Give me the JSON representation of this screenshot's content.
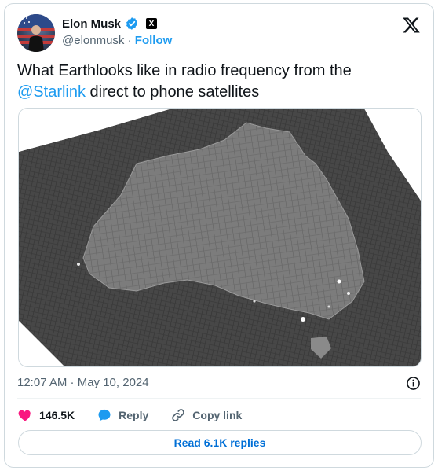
{
  "author": {
    "name": "Elon Musk",
    "handle": "@elonmusk",
    "separator": "·",
    "follow_label": "Follow"
  },
  "tweet": {
    "text_before": "What Earthlooks like in radio frequency from the",
    "mention": "@Starlink",
    "text_after": " direct to phone satellites"
  },
  "meta": {
    "timestamp": "12:07 AM · May 10, 2024"
  },
  "actions": {
    "likes": "146.5K",
    "reply_label": "Reply",
    "copy_link_label": "Copy link"
  },
  "read_replies": "Read 6.1K replies",
  "colors": {
    "accent": "#1d9bf0",
    "verified": "#1d9bf0",
    "like": "#f91880",
    "muted": "#536471"
  },
  "icons": {
    "verified": "verified-badge-icon",
    "brand": "x-logo-icon",
    "info": "info-icon",
    "like": "heart-icon",
    "reply": "speech-bubble-icon",
    "copy_link": "link-icon"
  }
}
